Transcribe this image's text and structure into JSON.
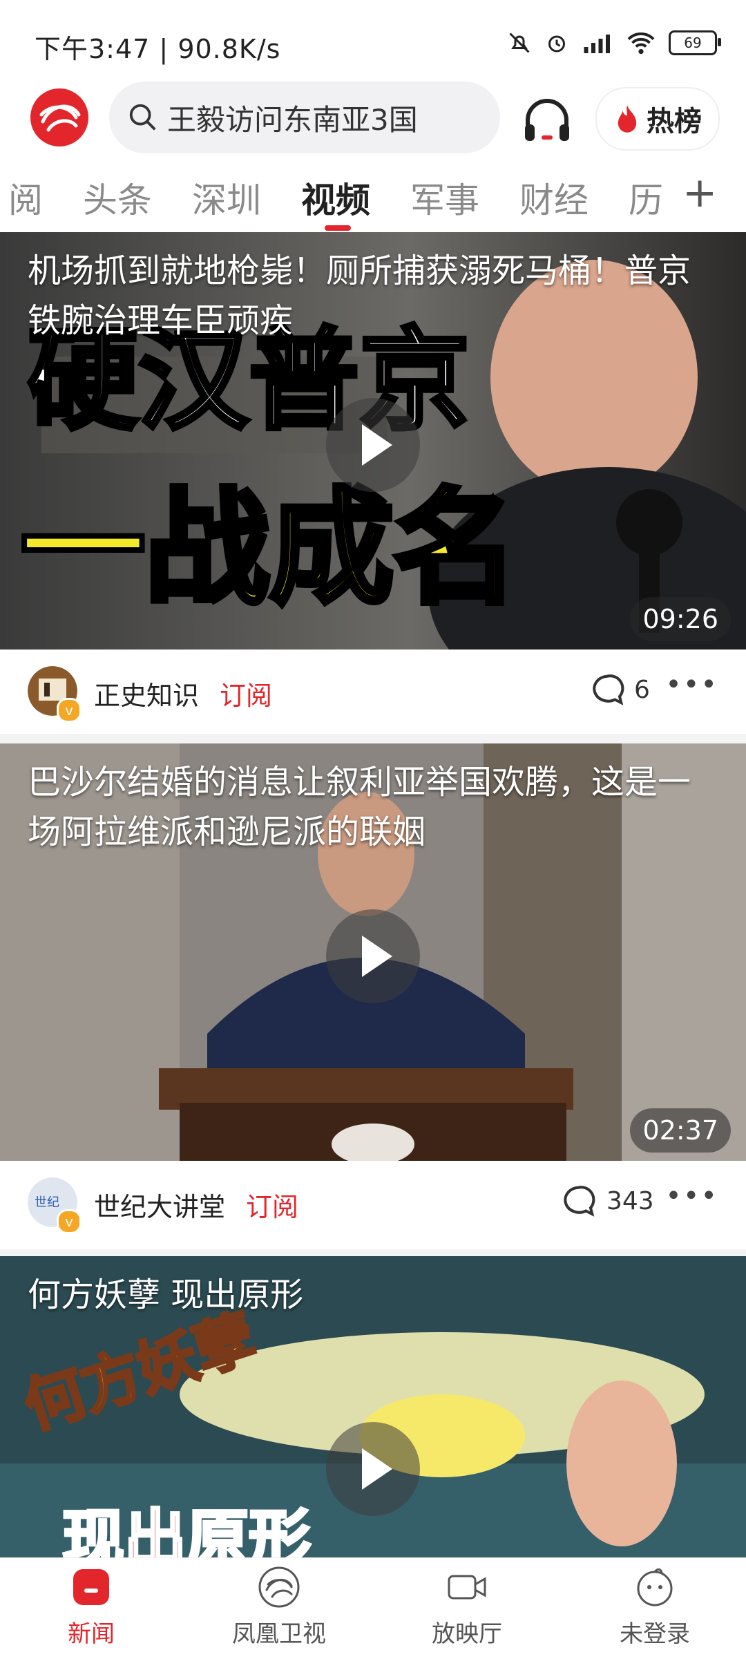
{
  "status_bar": {
    "time": "下午3:47",
    "net_speed": "90.8K/s",
    "battery": "69"
  },
  "header": {
    "search_placeholder": "王毅访问东南亚3国",
    "hot_label": "热榜",
    "accent_color": "#e2262b"
  },
  "tabs": [
    {
      "label": "阅"
    },
    {
      "label": "头条"
    },
    {
      "label": "深圳"
    },
    {
      "label": "视频",
      "active": true
    },
    {
      "label": "军事"
    },
    {
      "label": "财经"
    },
    {
      "label": "历"
    }
  ],
  "feed": [
    {
      "title": "机场抓到就地枪毙！厕所捕获溺死马桶！普京铁腕治理车臣顽疾",
      "overlay_line1": "硬汉普京",
      "overlay_line2": "一战成名",
      "duration": "09:26",
      "author": "正史知识",
      "subscribe": "订阅",
      "comments": "6"
    },
    {
      "title": "巴沙尔结婚的消息让叙利亚举国欢腾，这是一场阿拉维派和逊尼派的联姻",
      "duration": "02:37",
      "author": "世纪大讲堂",
      "subscribe": "订阅",
      "comments": "343"
    },
    {
      "title": "何方妖孽 现出原形",
      "overlay_line1": "何方妖孽",
      "overlay_line2": "现出原形"
    }
  ],
  "bottom_nav": [
    {
      "label": "新闻",
      "icon": "news-icon",
      "active": true
    },
    {
      "label": "凤凰卫视",
      "icon": "phoenix-tv-icon"
    },
    {
      "label": "放映厅",
      "icon": "video-camera-icon"
    },
    {
      "label": "未登录",
      "icon": "user-icon"
    }
  ]
}
